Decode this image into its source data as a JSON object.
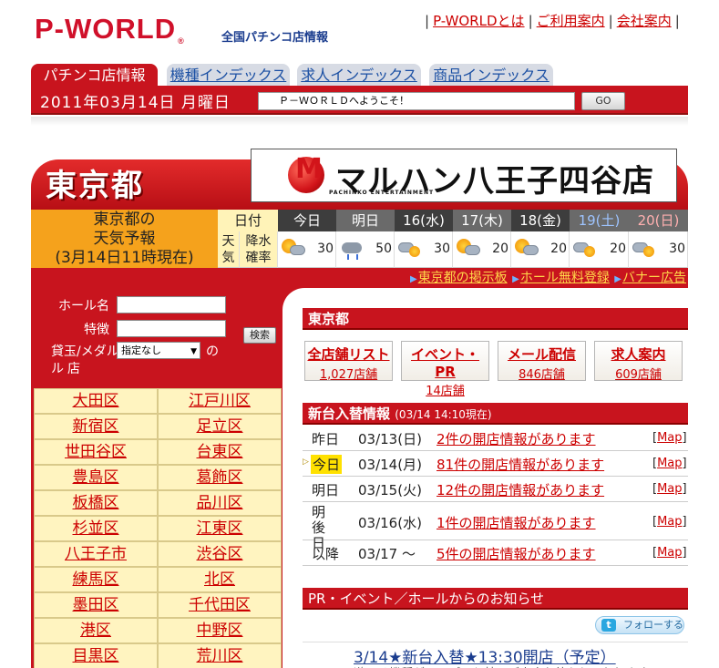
{
  "header": {
    "logo": "P-WORLD",
    "logo_reg": "®",
    "tagline": "全国パチンコ店情報",
    "links": [
      "P-WORLDとは",
      "ご利用案内",
      "会社案内"
    ]
  },
  "tabs": [
    "パチンコ店情報",
    "機種インデックス",
    "求人インデックス",
    "商品インデックス"
  ],
  "datebar": {
    "date": "2011年03月14日 月曜日",
    "welcome": "Ｐ－ＷＯＲＬＤへようこそ！",
    "go": "GO"
  },
  "region": {
    "title": "東京都",
    "banner_name": "マルハン八王子四谷店",
    "banner_sub": "PACHINKO ENTERTAINMENT"
  },
  "weather": {
    "label_line1": "東京都の",
    "label_line2": "天気予報",
    "label_line3": "(3月14日11時現在)",
    "col_head": "日付",
    "row_tenki": "天気",
    "row_kousui": "降水確率",
    "days": [
      {
        "label": "今日",
        "icon": "sun-cloud-icon",
        "pct": "30"
      },
      {
        "label": "明日",
        "icon": "rain-icon",
        "pct": "50"
      },
      {
        "label": "16(水)",
        "icon": "cloud-sun-icon",
        "pct": "30"
      },
      {
        "label": "17(木)",
        "icon": "sun-cloud-icon",
        "pct": "20"
      },
      {
        "label": "18(金)",
        "icon": "sun-cloud-icon",
        "pct": "20"
      },
      {
        "label": "19(土)",
        "icon": "cloud-sun-icon",
        "pct": "20"
      },
      {
        "label": "20(日)",
        "icon": "cloud-sun-icon",
        "pct": "30"
      }
    ]
  },
  "linkbar": [
    "東京都の掲示板",
    "ホール無料登録",
    "バナー広告"
  ],
  "search": {
    "hall_label": "ホール名",
    "feature_label": "特徴",
    "tamaMedal_label": "貸玉/メダル",
    "select_value": "指定なし",
    "suffix_no": "の",
    "suffix_ten": "店",
    "search_btn": "検索"
  },
  "areas": [
    "大田区",
    "江戸川区",
    "新宿区",
    "足立区",
    "世田谷区",
    "台東区",
    "豊島区",
    "葛飾区",
    "板橋区",
    "品川区",
    "杉並区",
    "江東区",
    "八王子市",
    "渋谷区",
    "練馬区",
    "北区",
    "墨田区",
    "千代田区",
    "港区",
    "中野区",
    "目黒区",
    "荒川区"
  ],
  "right": {
    "section_title": "東京都",
    "quick": [
      {
        "title": "全店舗リスト",
        "sub": "1,027店舗"
      },
      {
        "title": "イベント・PR",
        "sub": "14店舗"
      },
      {
        "title": "メール配信",
        "sub": "846店舗"
      },
      {
        "title": "求人案内",
        "sub": "609店舗"
      }
    ],
    "newmachines_title": "新台入替情報",
    "newmachines_time": "(03/14 14:10現在)",
    "rows": [
      {
        "when": "昨日",
        "date": "03/13(日)",
        "msg": "2件の開店情報があります",
        "map": "Map"
      },
      {
        "when": "今日",
        "date": "03/14(月)",
        "msg": "81件の開店情報があります",
        "map": "Map"
      },
      {
        "when": "明日",
        "date": "03/15(火)",
        "msg": "12件の開店情報があります",
        "map": "Map"
      },
      {
        "when": "明後日",
        "date": "03/16(水)",
        "msg": "1件の開店情報があります",
        "map": "Map"
      },
      {
        "when": "以降",
        "date": "03/17 ～",
        "msg": "5件の開店情報があります",
        "map": "Map"
      }
    ],
    "pr_title": "PR・イベント／ホールからのお知らせ",
    "follow": "フォローする",
    "news_title": "3/14★新台入替★13:30開店（予定）",
    "news_sub": "遊べる機種がいっぱい入替、ご来店お待ちしております"
  }
}
